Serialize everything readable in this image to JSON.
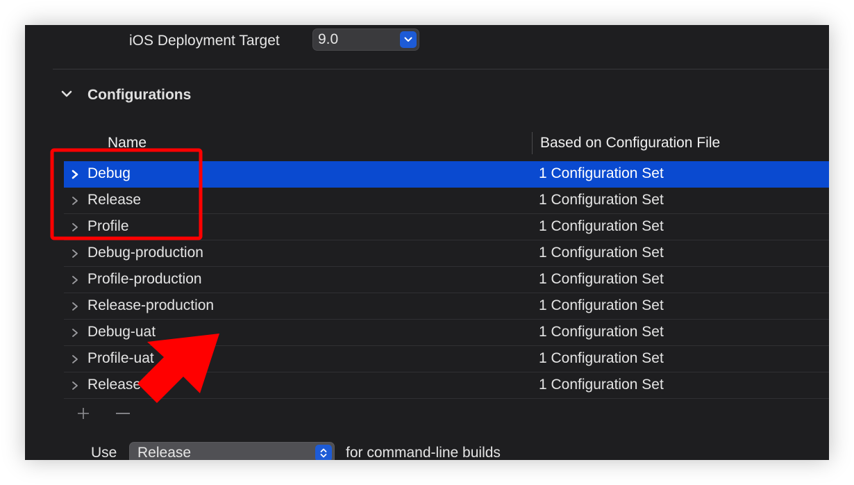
{
  "deployment": {
    "label": "iOS Deployment Target",
    "value": "9.0"
  },
  "configurations": {
    "title": "Configurations",
    "columns": {
      "name": "Name",
      "based_on": "Based on Configuration File"
    },
    "rows": [
      {
        "name": "Debug",
        "based_on": "1 Configuration Set",
        "selected": true
      },
      {
        "name": "Release",
        "based_on": "1 Configuration Set"
      },
      {
        "name": "Profile",
        "based_on": "1 Configuration Set"
      },
      {
        "name": "Debug-production",
        "based_on": "1 Configuration Set"
      },
      {
        "name": "Profile-production",
        "based_on": "1 Configuration Set"
      },
      {
        "name": "Release-production",
        "based_on": "1 Configuration Set"
      },
      {
        "name": "Debug-uat",
        "based_on": "1 Configuration Set"
      },
      {
        "name": "Profile-uat",
        "based_on": "1 Configuration Set"
      },
      {
        "name": "Release-uat",
        "based_on": "1 Configuration Set"
      }
    ],
    "add_symbol": "+",
    "remove_symbol": "—"
  },
  "command_line": {
    "prefix": "Use",
    "selected": "Release",
    "suffix": "for command-line builds"
  },
  "colors": {
    "background": "#1e1e20",
    "selection": "#0a4ad0",
    "accent_button": "#1d5bd6",
    "annotation": "#ff0000"
  },
  "icons": {
    "disclosure": "chevron-right-icon",
    "section": "chevron-down-icon",
    "popup": "up-down-arrows-icon"
  }
}
